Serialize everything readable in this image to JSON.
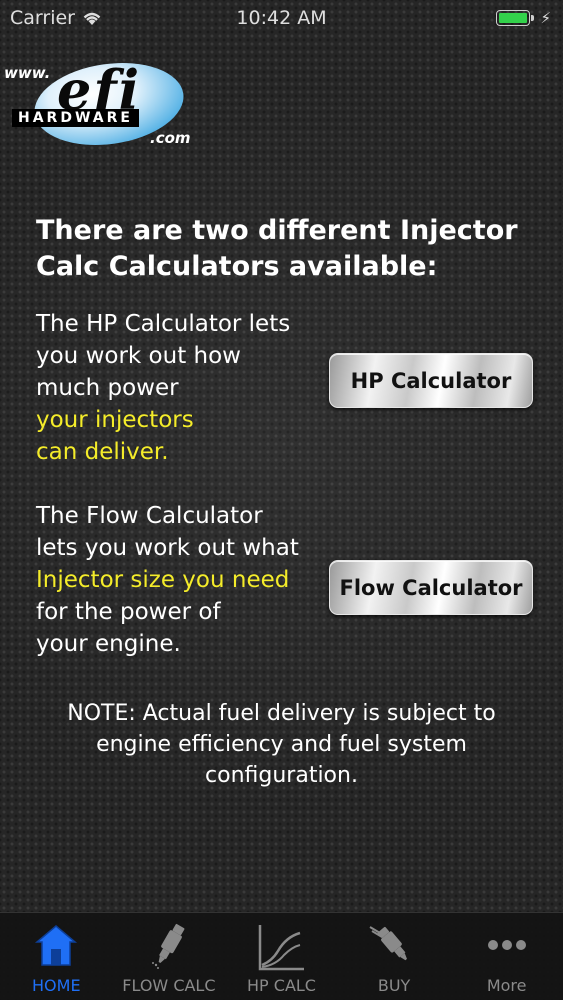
{
  "status_bar": {
    "carrier": "Carrier",
    "time": "10:42 AM",
    "battery_color": "#33d14b"
  },
  "logo": {
    "www": "www.",
    "brand": "efi",
    "hardware": "HARDWARE",
    "com": ".com"
  },
  "heading": "There are two different Injector Calc Calculators available:",
  "hp_section": {
    "lines": [
      "The HP Calculator lets",
      "you work out how",
      "much power"
    ],
    "highlight_lines": [
      "your injectors",
      "can deliver."
    ],
    "button_label": "HP Calculator"
  },
  "flow_section": {
    "lines_before": [
      "The Flow Calculator",
      "lets you work out what"
    ],
    "highlight_line": "Injector size you need",
    "lines_after": [
      "for the power of",
      "your engine."
    ],
    "button_label": "Flow Calculator"
  },
  "note": "NOTE: Actual fuel delivery is subject to engine efficiency and fuel system configuration.",
  "colors": {
    "highlight": "#f4ec2a",
    "tab_active": "#1f6ff5",
    "tab_inactive": "#8a8a8a"
  },
  "tabs": [
    {
      "label": "HOME",
      "icon": "home-icon",
      "active": true
    },
    {
      "label": "FLOW CALC",
      "icon": "injector-icon",
      "active": false
    },
    {
      "label": "HP CALC",
      "icon": "graph-icon",
      "active": false
    },
    {
      "label": "BUY",
      "icon": "injector-buy-icon",
      "active": false
    },
    {
      "label": "More",
      "icon": "more-icon",
      "active": false
    }
  ]
}
